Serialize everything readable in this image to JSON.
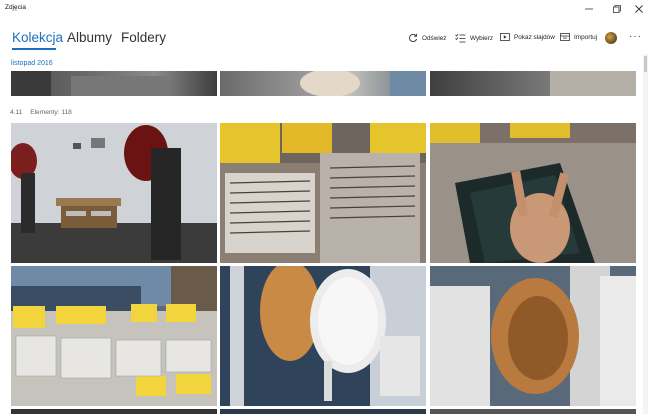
{
  "window": {
    "title": "Zdjęcia"
  },
  "tabs": [
    {
      "label": "Kolekcja",
      "active": true
    },
    {
      "label": "Albumy",
      "active": false
    },
    {
      "label": "Foldery",
      "active": false
    }
  ],
  "toolbar": {
    "refresh": "Odśwież",
    "select": "Wybierz",
    "slideshow": "Pokaz slajdów",
    "import": "Importuj"
  },
  "colors": {
    "accent": "#1a6fc2"
  },
  "sections": {
    "previous_month": "listopad 2016",
    "group_date": "4.11",
    "group_count": "Elementy: 118"
  },
  "photos": [
    "partial-photo-left",
    "partial-photo-middle",
    "partial-photo-right",
    "audio-equipment-room",
    "vinyl-record-crates",
    "hand-with-metallica-record",
    "record-fair-stalls",
    "white-headphones",
    "headphone-earcup-closeup"
  ]
}
